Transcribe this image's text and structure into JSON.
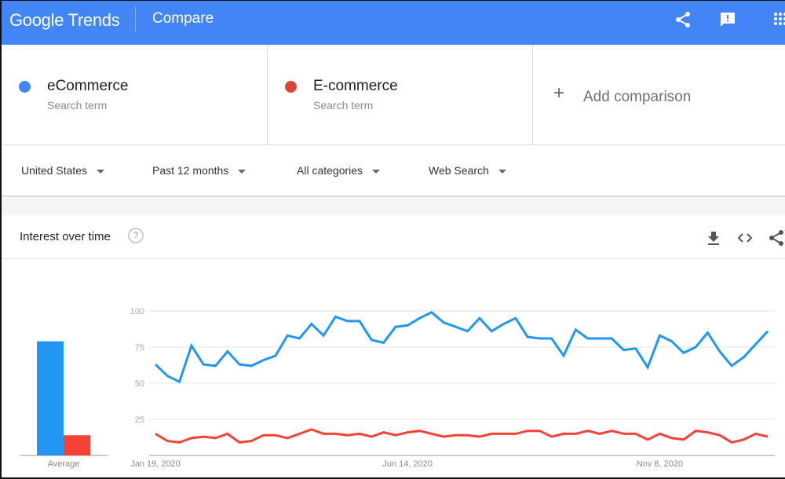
{
  "app": {
    "logo": "Google Trends",
    "page_title": "Compare"
  },
  "topbar_icons": [
    "share-icon",
    "feedback-icon",
    "apps-grid-icon"
  ],
  "terms": [
    {
      "name": "eCommerce",
      "subtitle": "Search term",
      "color": "#4285f4"
    },
    {
      "name": "E-commerce",
      "subtitle": "Search term",
      "color": "#db4437"
    }
  ],
  "add_comparison": {
    "icon": "+",
    "label": "Add comparison"
  },
  "filters": [
    {
      "label": "United States"
    },
    {
      "label": "Past 12 months"
    },
    {
      "label": "All categories"
    },
    {
      "label": "Web Search"
    }
  ],
  "section": {
    "title": "Interest over time",
    "help_icon": "?",
    "actions": [
      "download-icon",
      "embed-icon",
      "share-icon"
    ]
  },
  "colors": {
    "series1": "#2196f3",
    "series2": "#f44336",
    "brand": "#4285f4"
  },
  "chart_data": [
    {
      "type": "bar",
      "title": "Average",
      "categories": [
        "Average"
      ],
      "series": [
        {
          "name": "eCommerce",
          "values": [
            79
          ]
        },
        {
          "name": "E-commerce",
          "values": [
            14
          ]
        }
      ],
      "xlabel": "Average",
      "ylim": [
        0,
        100
      ]
    },
    {
      "type": "line",
      "title": "Interest over time",
      "xlabel": "",
      "ylabel": "",
      "ylim": [
        0,
        100
      ],
      "yticks": [
        25,
        50,
        75,
        100
      ],
      "grid": true,
      "x_start": "Jan 19, 2020",
      "x_interval": "weekly",
      "xtick_labels": [
        {
          "label": "Jan 19, 2020",
          "index": 0
        },
        {
          "label": "Jun 14, 2020",
          "index": 21
        },
        {
          "label": "Nov 8, 2020",
          "index": 42
        }
      ],
      "series": [
        {
          "name": "eCommerce",
          "values": [
            63,
            55,
            51,
            76,
            63,
            62,
            72,
            63,
            62,
            66,
            69,
            83,
            81,
            91,
            83,
            96,
            93,
            93,
            80,
            78,
            89,
            90,
            95,
            99,
            92,
            89,
            86,
            95,
            86,
            91,
            95,
            82,
            81,
            81,
            69,
            87,
            81,
            81,
            81,
            73,
            74,
            61,
            83,
            79,
            71,
            75,
            85,
            72,
            62,
            68,
            77,
            86
          ]
        },
        {
          "name": "E-commerce",
          "values": [
            15,
            10,
            9,
            12,
            13,
            12,
            15,
            9,
            10,
            14,
            14,
            12,
            15,
            18,
            15,
            15,
            14,
            15,
            13,
            16,
            14,
            16,
            17,
            15,
            13,
            14,
            14,
            13,
            15,
            15,
            15,
            17,
            17,
            13,
            15,
            15,
            17,
            15,
            17,
            15,
            15,
            11,
            15,
            12,
            11,
            17,
            16,
            14,
            9,
            11,
            15,
            13
          ]
        }
      ]
    }
  ]
}
